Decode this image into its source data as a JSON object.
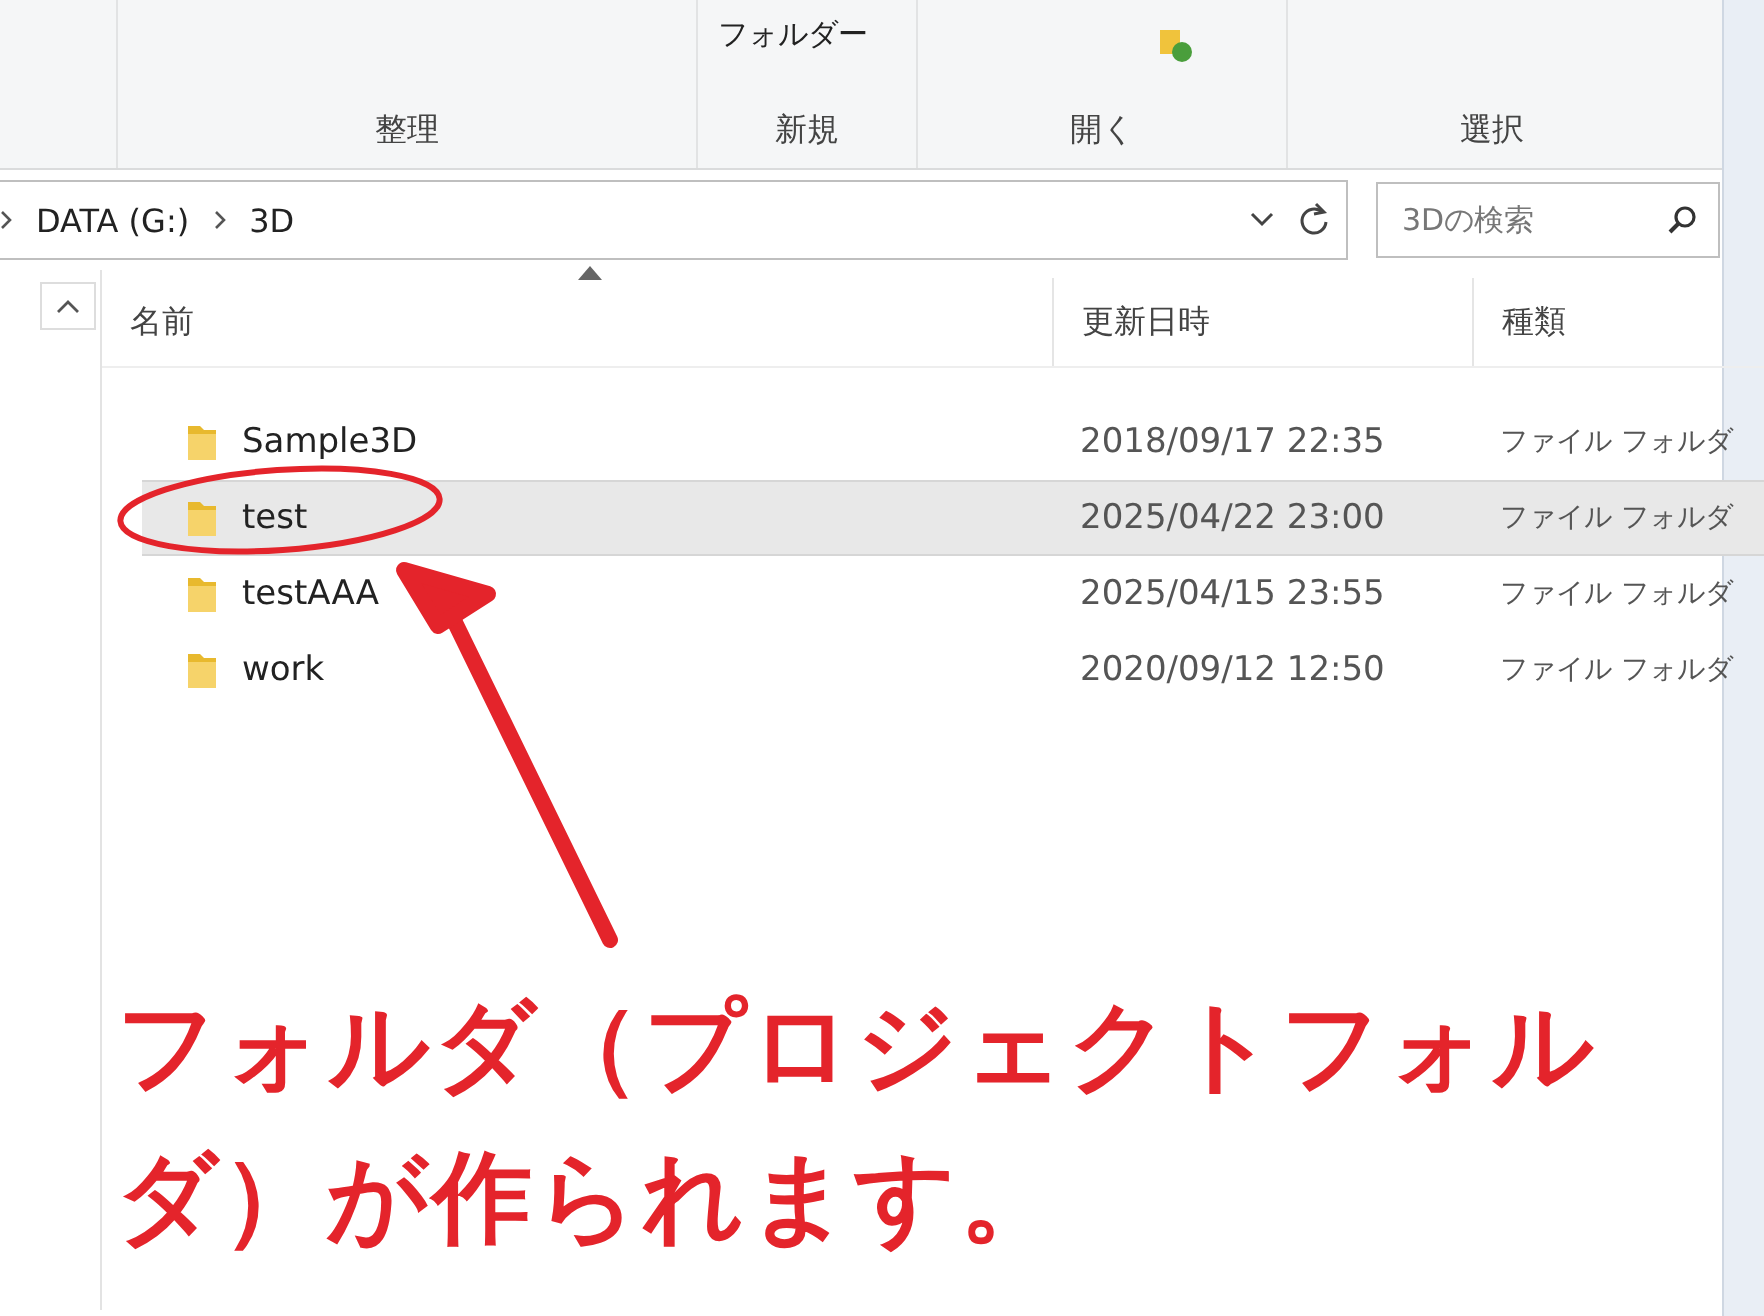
{
  "ribbon": {
    "partial_label": "フォルダー",
    "groups": [
      "整理",
      "新規",
      "開く",
      "選択"
    ]
  },
  "address_bar": {
    "breadcrumbs": [
      "DATA (G:)",
      "3D"
    ]
  },
  "search": {
    "placeholder": "3Dの検索"
  },
  "columns": [
    "名前",
    "更新日時",
    "種類"
  ],
  "rows": [
    {
      "name": "Sample3D",
      "modified": "2018/09/17 22:35",
      "type": "ファイル フォルダ",
      "selected": false,
      "circled": false
    },
    {
      "name": "test",
      "modified": "2025/04/22 23:00",
      "type": "ファイル フォルダ",
      "selected": true,
      "circled": true
    },
    {
      "name": "testAAA",
      "modified": "2025/04/15 23:55",
      "type": "ファイル フォルダ",
      "selected": false,
      "circled": false
    },
    {
      "name": "work",
      "modified": "2020/09/12 12:50",
      "type": "ファイル フォルダ",
      "selected": false,
      "circled": false
    }
  ],
  "annotation": {
    "text": "フォルダ（プロジェクトフォルダ）が作られます。"
  }
}
